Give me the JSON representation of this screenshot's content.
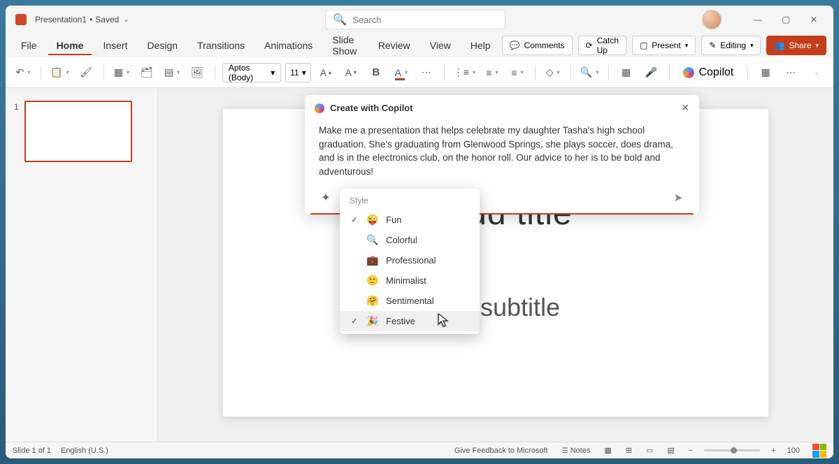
{
  "titlebar": {
    "doc_name": "Presentation1",
    "save_state": "Saved",
    "search_placeholder": "Search"
  },
  "tabs": {
    "items": [
      "File",
      "Home",
      "Insert",
      "Design",
      "Transitions",
      "Animations",
      "Slide Show",
      "Review",
      "View",
      "Help"
    ],
    "active_index": 1
  },
  "header_buttons": {
    "comments": "Comments",
    "catchup": "Catch Up",
    "present": "Present",
    "editing": "Editing",
    "share": "Share"
  },
  "ribbon": {
    "font_name": "Aptos (Body)",
    "font_size": "11",
    "copilot_label": "Copilot"
  },
  "thumbnail": {
    "number": "1"
  },
  "slide": {
    "title_placeholder": "o add title",
    "subtitle_placeholder": "add subtitle"
  },
  "copilot": {
    "title": "Create with Copilot",
    "prompt": "Make me a presentation that helps celebrate my daughter Tasha's high school graduation. She's graduating from Glenwood Springs, she plays soccer, does drama, and is in the electronics club, on the honor roll. Our advice to her is to be bold and adventurous!"
  },
  "style_menu": {
    "label": "Style",
    "items": [
      {
        "label": "Fun",
        "emoji": "😜",
        "checked": true,
        "hovered": false
      },
      {
        "label": "Colorful",
        "emoji": "🔍",
        "checked": false,
        "hovered": false
      },
      {
        "label": "Professional",
        "emoji": "💼",
        "checked": false,
        "hovered": false
      },
      {
        "label": "Minimalist",
        "emoji": "🙂",
        "checked": false,
        "hovered": false
      },
      {
        "label": "Sentimental",
        "emoji": "🤗",
        "checked": false,
        "hovered": false
      },
      {
        "label": "Festive",
        "emoji": "🎉",
        "checked": true,
        "hovered": true
      }
    ]
  },
  "status": {
    "slide_info": "Slide 1 of 1",
    "language": "English (U.S.)",
    "feedback": "Give Feedback to Microsoft",
    "notes": "Notes",
    "zoom": "100"
  }
}
